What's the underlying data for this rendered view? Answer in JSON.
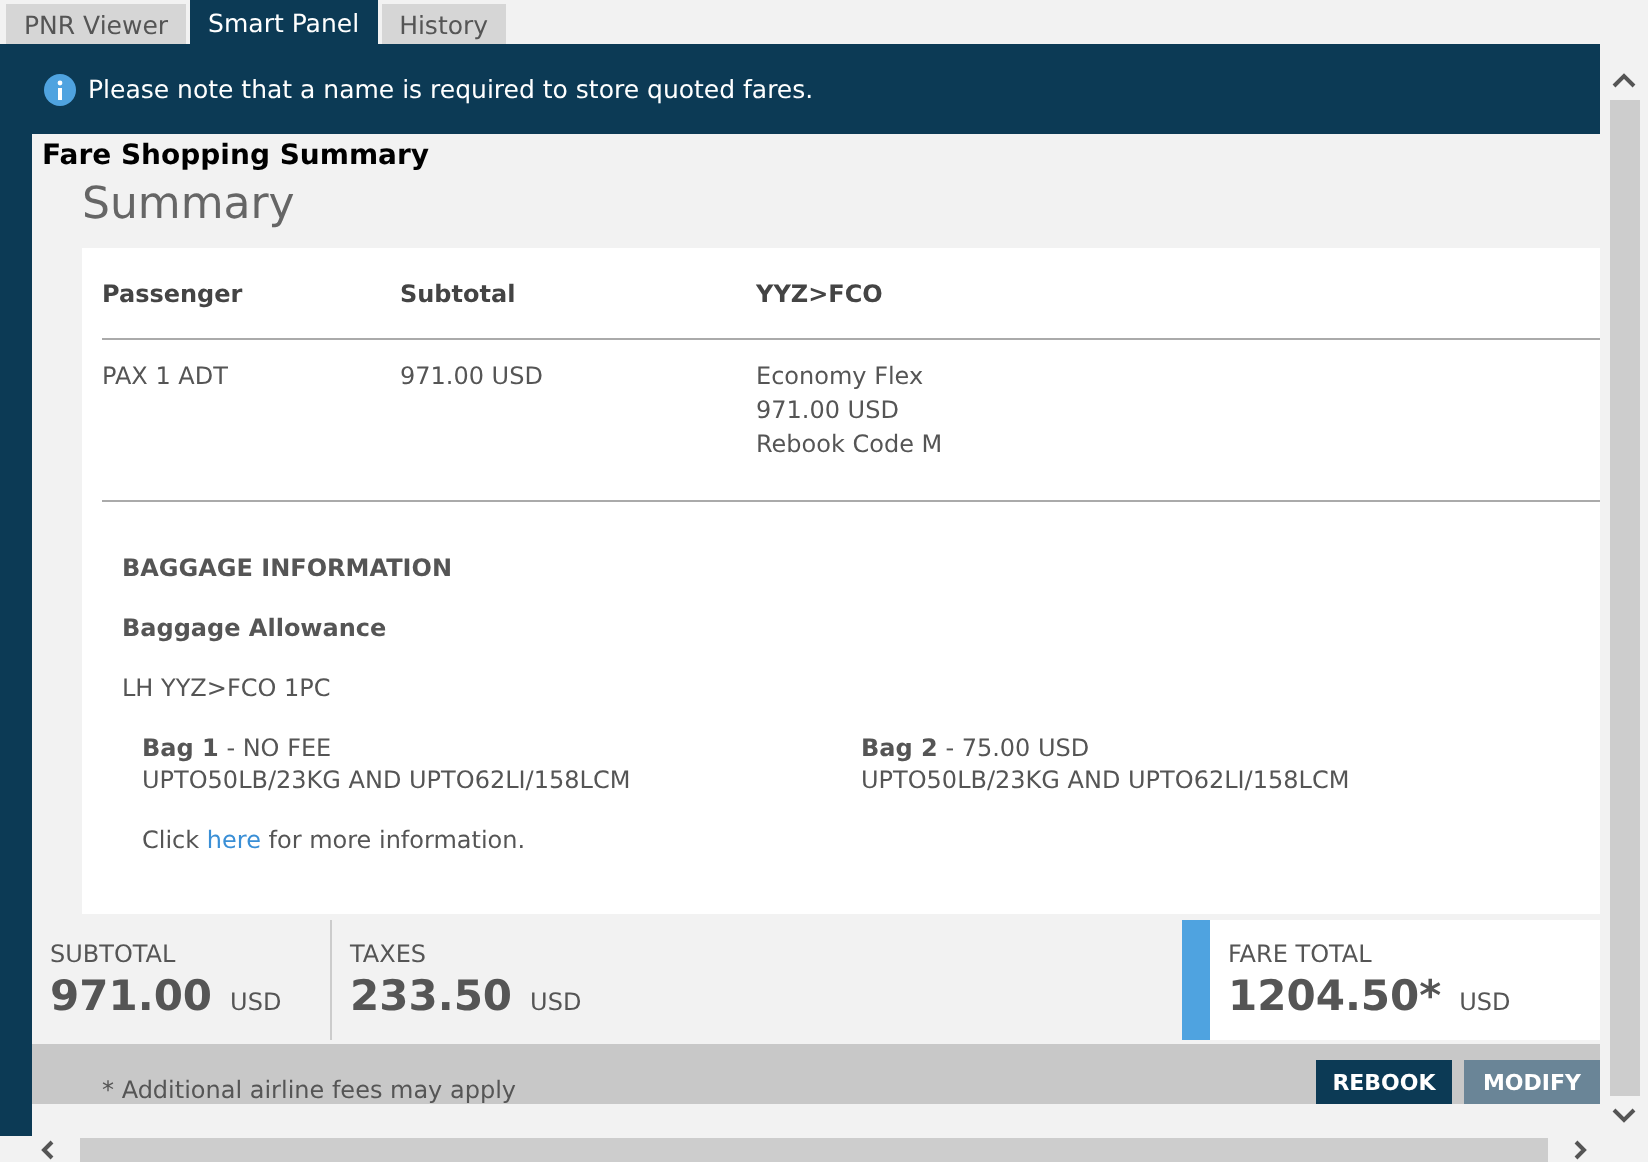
{
  "tabs": [
    {
      "label": "PNR Viewer",
      "selected": false
    },
    {
      "label": "Smart Panel",
      "selected": true
    },
    {
      "label": "History",
      "selected": false
    }
  ],
  "notice": {
    "text": "Please note that a name is required to store quoted fares."
  },
  "panel_title": "Fare Shopping Summary",
  "summary": {
    "heading": "Summary",
    "columns": [
      "Passenger",
      "Subtotal",
      "YYZ>FCO"
    ],
    "rows": [
      {
        "passenger": "PAX 1 ADT",
        "subtotal": "971.00 USD",
        "segment": [
          "Economy Flex",
          "971.00 USD",
          "Rebook Code M"
        ]
      }
    ]
  },
  "baggage": {
    "heading": "BAGGAGE INFORMATION",
    "subheading": "Baggage Allowance",
    "route": "LH YYZ>FCO 1PC",
    "bags": [
      {
        "name": "Bag 1",
        "fee": " - NO FEE",
        "rule": "UPTO50LB/23KG AND UPTO62LI/158LCM"
      },
      {
        "name": "Bag 2",
        "fee": " - 75.00 USD",
        "rule": "UPTO50LB/23KG AND UPTO62LI/158LCM"
      }
    ],
    "more_info": {
      "before": "Click ",
      "link": "here",
      "after": " for more information."
    }
  },
  "totals": [
    {
      "label": "SUBTOTAL",
      "amount": "971.00",
      "currency": "USD",
      "highlight": false
    },
    {
      "label": "TAXES",
      "amount": "233.50",
      "currency": "USD",
      "highlight": false
    },
    {
      "label": "FARE TOTAL",
      "amount": "1204.50*",
      "currency": "USD",
      "highlight": true
    }
  ],
  "footnote": "* Additional airline fees may apply",
  "buttons": [
    {
      "label": "REBOOK",
      "kind": "primary"
    },
    {
      "label": "MODIFY",
      "kind": "secondary"
    }
  ]
}
